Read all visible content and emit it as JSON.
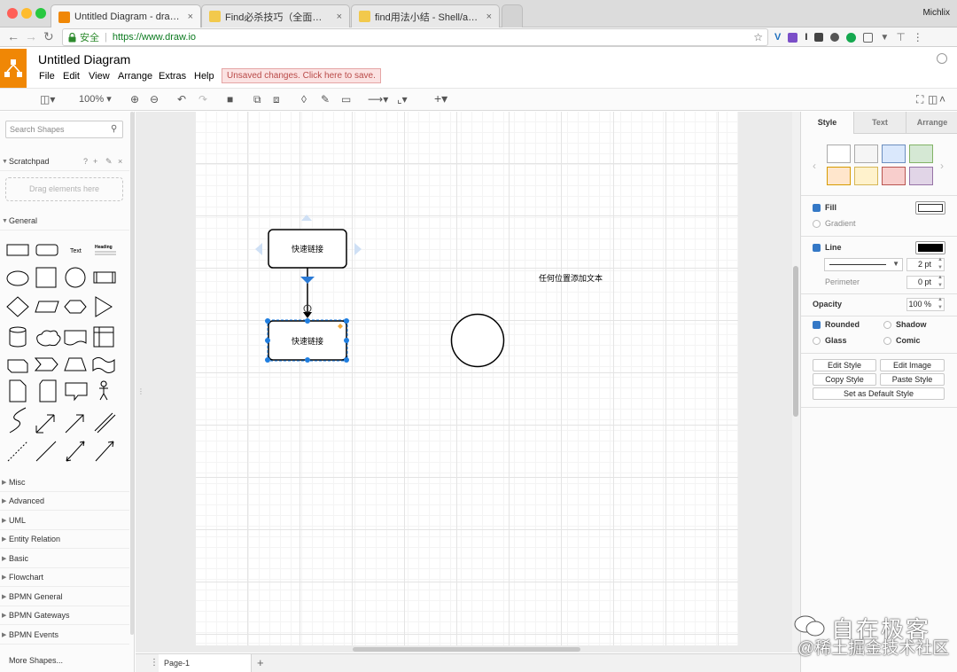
{
  "browser": {
    "tabs": [
      {
        "title": "Untitled Diagram - draw.io",
        "close": "×"
      },
      {
        "title": "Find必杀技巧（全面撑握find使",
        "close": "×"
      },
      {
        "title": "find用法小结 - Shell/awk/sed",
        "close": "×"
      }
    ],
    "profile": "Michlix",
    "secure_label": "安全",
    "url": "https://www.draw.io",
    "colors": {
      "close": "#ff5f57",
      "minimize": "#febc2e",
      "zoom": "#28c840"
    }
  },
  "app": {
    "title": "Untitled Diagram",
    "menus": [
      "File",
      "Edit",
      "View",
      "Arrange",
      "Extras",
      "Help"
    ],
    "unsaved": "Unsaved changes. Click here to save.",
    "accent": "#f08705"
  },
  "toolbar": {
    "zoom": "100%"
  },
  "left_panel": {
    "search_placeholder": "Search Shapes",
    "scratchpad": "Scratchpad",
    "scratch_help": "?",
    "drag_hint": "Drag elements here",
    "general": "General",
    "text_shape": "Text",
    "heading_shape": "Heading",
    "sections": [
      "Misc",
      "Advanced",
      "UML",
      "Entity Relation",
      "Basic",
      "Flowchart",
      "BPMN General",
      "BPMN Gateways",
      "BPMN Events"
    ],
    "more_shapes": "More Shapes..."
  },
  "canvas": {
    "box1_label": "快速链接",
    "box2_label": "快速链接",
    "free_text": "任何位置添加文本",
    "page_tab": "Page-1",
    "selection_color": "#1f7ee0"
  },
  "right_panel": {
    "tabs": [
      "Style",
      "Text",
      "Arrange"
    ],
    "swatches": [
      "#ffffff",
      "#f5f5f5",
      "#dae8fc",
      "#d5e8d4",
      "#ffe6cc",
      "#fff2cc",
      "#f8cecc",
      "#e1d5e7"
    ],
    "fill": "Fill",
    "gradient": "Gradient",
    "line": "Line",
    "line_width": "2 pt",
    "perimeter": "Perimeter",
    "perimeter_value": "0 pt",
    "opacity": "Opacity",
    "opacity_value": "100 %",
    "rounded": "Rounded",
    "shadow": "Shadow",
    "glass": "Glass",
    "comic": "Comic",
    "buttons": [
      "Edit Style",
      "Edit Image",
      "Copy Style",
      "Paste Style",
      "Set as Default Style"
    ]
  },
  "watermark": {
    "line1": "自在极客",
    "line2": "@稀土掘金技术社区"
  }
}
